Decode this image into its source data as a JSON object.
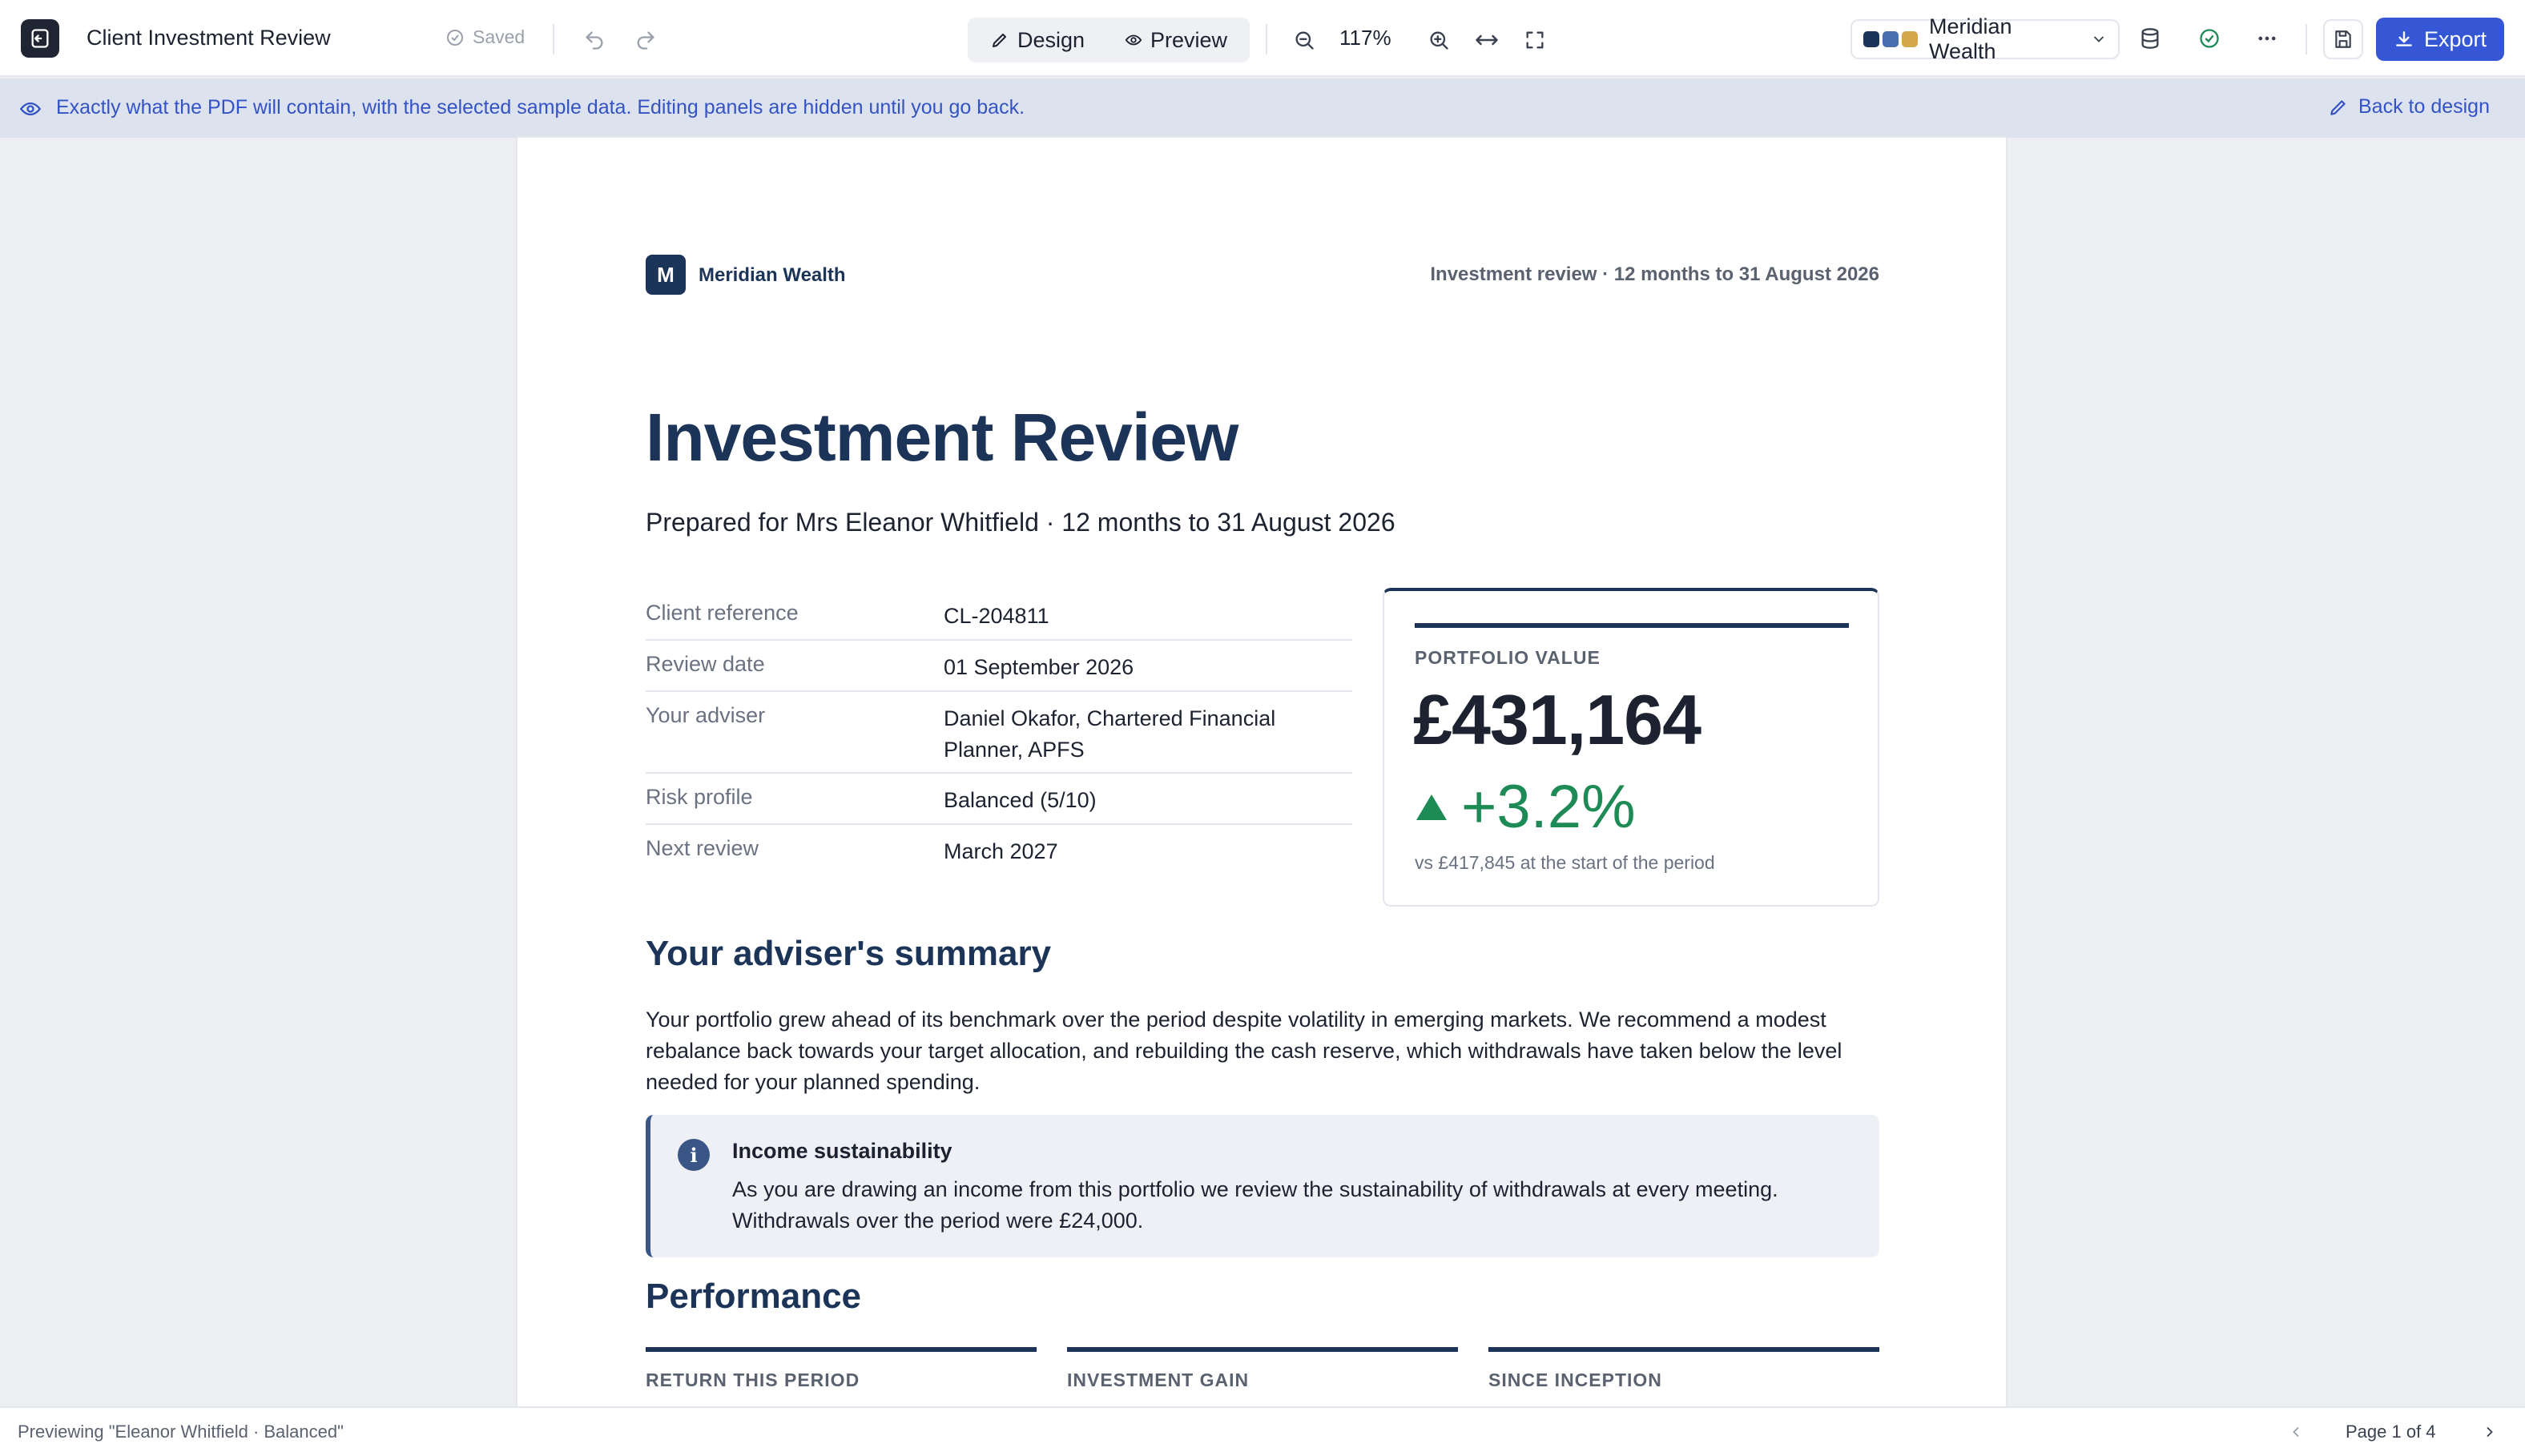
{
  "toolbar": {
    "doc_title": "Client Investment Review",
    "saved_label": "Saved",
    "design_label": "Design",
    "preview_label": "Preview",
    "zoom": "117%",
    "brand_name": "Meridian Wealth",
    "brand_swatches": [
      "#1c3458",
      "#4a6fb0",
      "#d4a84a"
    ],
    "export_label": "Export",
    "accent_color": "#3557d6"
  },
  "banner": {
    "text": "Exactly what the PDF will contain, with the selected sample data. Editing panels are hidden until you go back.",
    "back_label": "Back to design"
  },
  "document": {
    "logo_letter": "M",
    "brand_name": "Meridian Wealth",
    "header_right": "Investment review · 12 months to 31 August 2026",
    "title": "Investment Review",
    "subtitle": "Prepared for Mrs Eleanor Whitfield · 12 months to 31 August 2026",
    "details": [
      {
        "label": "Client reference",
        "value": "CL-204811"
      },
      {
        "label": "Review date",
        "value": "01 September 2026"
      },
      {
        "label": "Your adviser",
        "value": "Daniel Okafor, Chartered Financial Planner, APFS"
      },
      {
        "label": "Risk profile",
        "value": "Balanced (5/10)"
      },
      {
        "label": "Next review",
        "value": "March 2027"
      }
    ],
    "portfolio": {
      "label": "PORTFOLIO VALUE",
      "value": "£431,164",
      "change": "+3.2%",
      "note": "vs £417,845 at the start of the period",
      "positive_color": "#1e8a56"
    },
    "summary_heading": "Your adviser's summary",
    "summary_text": "Your portfolio grew ahead of its benchmark over the period despite volatility in emerging markets. We recommend a modest rebalance back towards your target allocation, and rebuilding the cash reserve, which withdrawals have taken below the level needed for your planned spending.",
    "callout": {
      "icon": "i",
      "title": "Income sustainability",
      "body": "As you are drawing an income from this portfolio we review the sustainability of withdrawals at every meeting. Withdrawals over the period were £24,000."
    },
    "performance_heading": "Performance",
    "kpis": [
      {
        "label": "RETURN THIS PERIOD"
      },
      {
        "label": "INVESTMENT GAIN"
      },
      {
        "label": "SINCE INCEPTION"
      }
    ]
  },
  "status": {
    "previewing": "Previewing \"Eleanor Whitfield · Balanced\"",
    "page_indicator": "Page 1 of 4"
  }
}
